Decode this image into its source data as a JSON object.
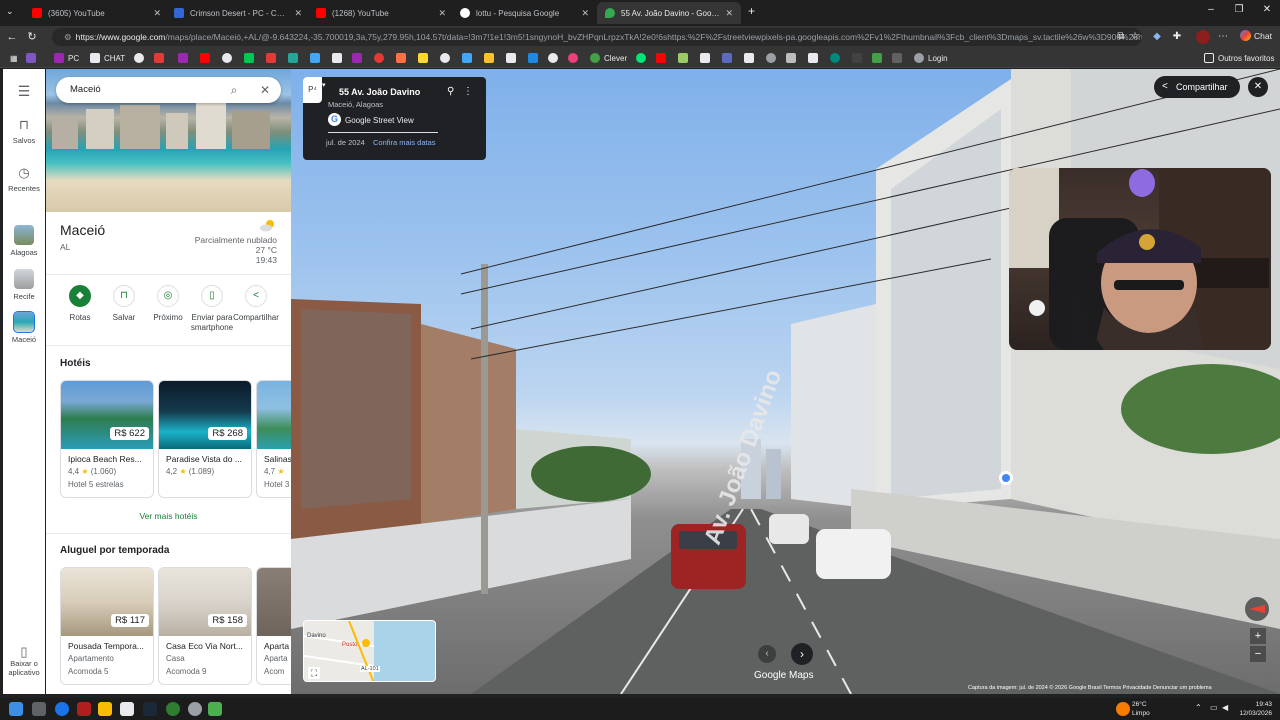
{
  "browser": {
    "tabs": [
      {
        "label": "(3605) YouTube",
        "color": "#ff0000"
      },
      {
        "label": "Crimson Desert - PC - Compre na",
        "color": "#3367d6"
      },
      {
        "label": "(1268) YouTube",
        "color": "#ff0000"
      },
      {
        "label": "lottu - Pesquisa Google",
        "color": "#ffffff"
      },
      {
        "label": "55 Av. João Davino - Google Maps",
        "color": "#34a853"
      }
    ],
    "new_tab": "+",
    "url_host": "https://www.google.com",
    "url_rest": "/maps/place/Maceió,+AL/@-9.643224,-35.700019,3a,75y,279.95h,104.57t/data=!3m7!1e1!3m5!1sngynoH_bvZHPqnLrpzxTkA!2e0!6shttps:%2F%2Fstreetviewpixels-pa.googleapis.com%2Fv1%2Fthumbnail%3Fcb_client%3Dmaps_sv.tactile%26w%3D900%26h...",
    "chat_label": "Chat",
    "bookmarks": [
      "PC",
      "CHAT",
      "Clever",
      "Login"
    ],
    "other_bookmarks": "Outros favoritos"
  },
  "search": {
    "query": "Maceió"
  },
  "rail": {
    "items": [
      "Salvos",
      "Recentes",
      "Alagoas",
      "Recife",
      "Maceió"
    ],
    "bottom": "Baixar o aplicativo"
  },
  "place": {
    "title": "Maceió",
    "region": "AL",
    "weather": {
      "condition": "Parcialmente nublado",
      "temp": "27 °C",
      "time": "19:43"
    },
    "actions": [
      "Rotas",
      "Salvar",
      "Próximo",
      "Enviar para smartphone",
      "Compartilhar"
    ]
  },
  "hotels": {
    "heading": "Hotéis",
    "items": [
      {
        "name": "Ipioca Beach Res...",
        "price": "R$ 622",
        "rating": "4,4",
        "reviews": "(1.060)",
        "type": "Hotel 5 estrelas"
      },
      {
        "name": "Paradise Vista do ...",
        "price": "R$ 268",
        "rating": "4,2",
        "reviews": "(1.089)",
        "type": ""
      },
      {
        "name": "Salinas",
        "price": "",
        "rating": "4,7",
        "reviews": "",
        "type": "Hotel 3"
      }
    ],
    "more": "Ver mais hotéis"
  },
  "rentals": {
    "heading": "Aluguel por temporada",
    "items": [
      {
        "name": "Pousada Tempora...",
        "price": "R$ 117",
        "type": "Apartamento",
        "guests": "Acomoda 5"
      },
      {
        "name": "Casa Eco Via Nort...",
        "price": "R$ 158",
        "type": "Casa",
        "guests": "Acomoda 9"
      },
      {
        "name": "Aparta",
        "price": "",
        "type": "Aparta",
        "guests": "Acom"
      }
    ]
  },
  "streetview": {
    "address": "55 Av. João Davino",
    "city": "Maceió, Alagoas",
    "brand": "Google Street View",
    "date": "jul. de 2024",
    "dates_link": "Confira mais datas",
    "share": "Compartilhar",
    "logo": "Google Maps",
    "footer": "Captura da imagem: jul. de 2024   © 2026 Google   Brasil   Termos   Privacidade   Denunciar um problema",
    "street_label": "Av. João Davino",
    "minimap_labels": [
      "Davino",
      "Posto",
      "AL-101"
    ]
  },
  "taskbar": {
    "weather_temp": "26°C",
    "weather_desc": "Limpo",
    "time": "19:43",
    "date": "12/03/2026"
  },
  "colors": {
    "maps_green": "#188038",
    "dark_panel": "#202124",
    "star": "#fbbc04"
  }
}
